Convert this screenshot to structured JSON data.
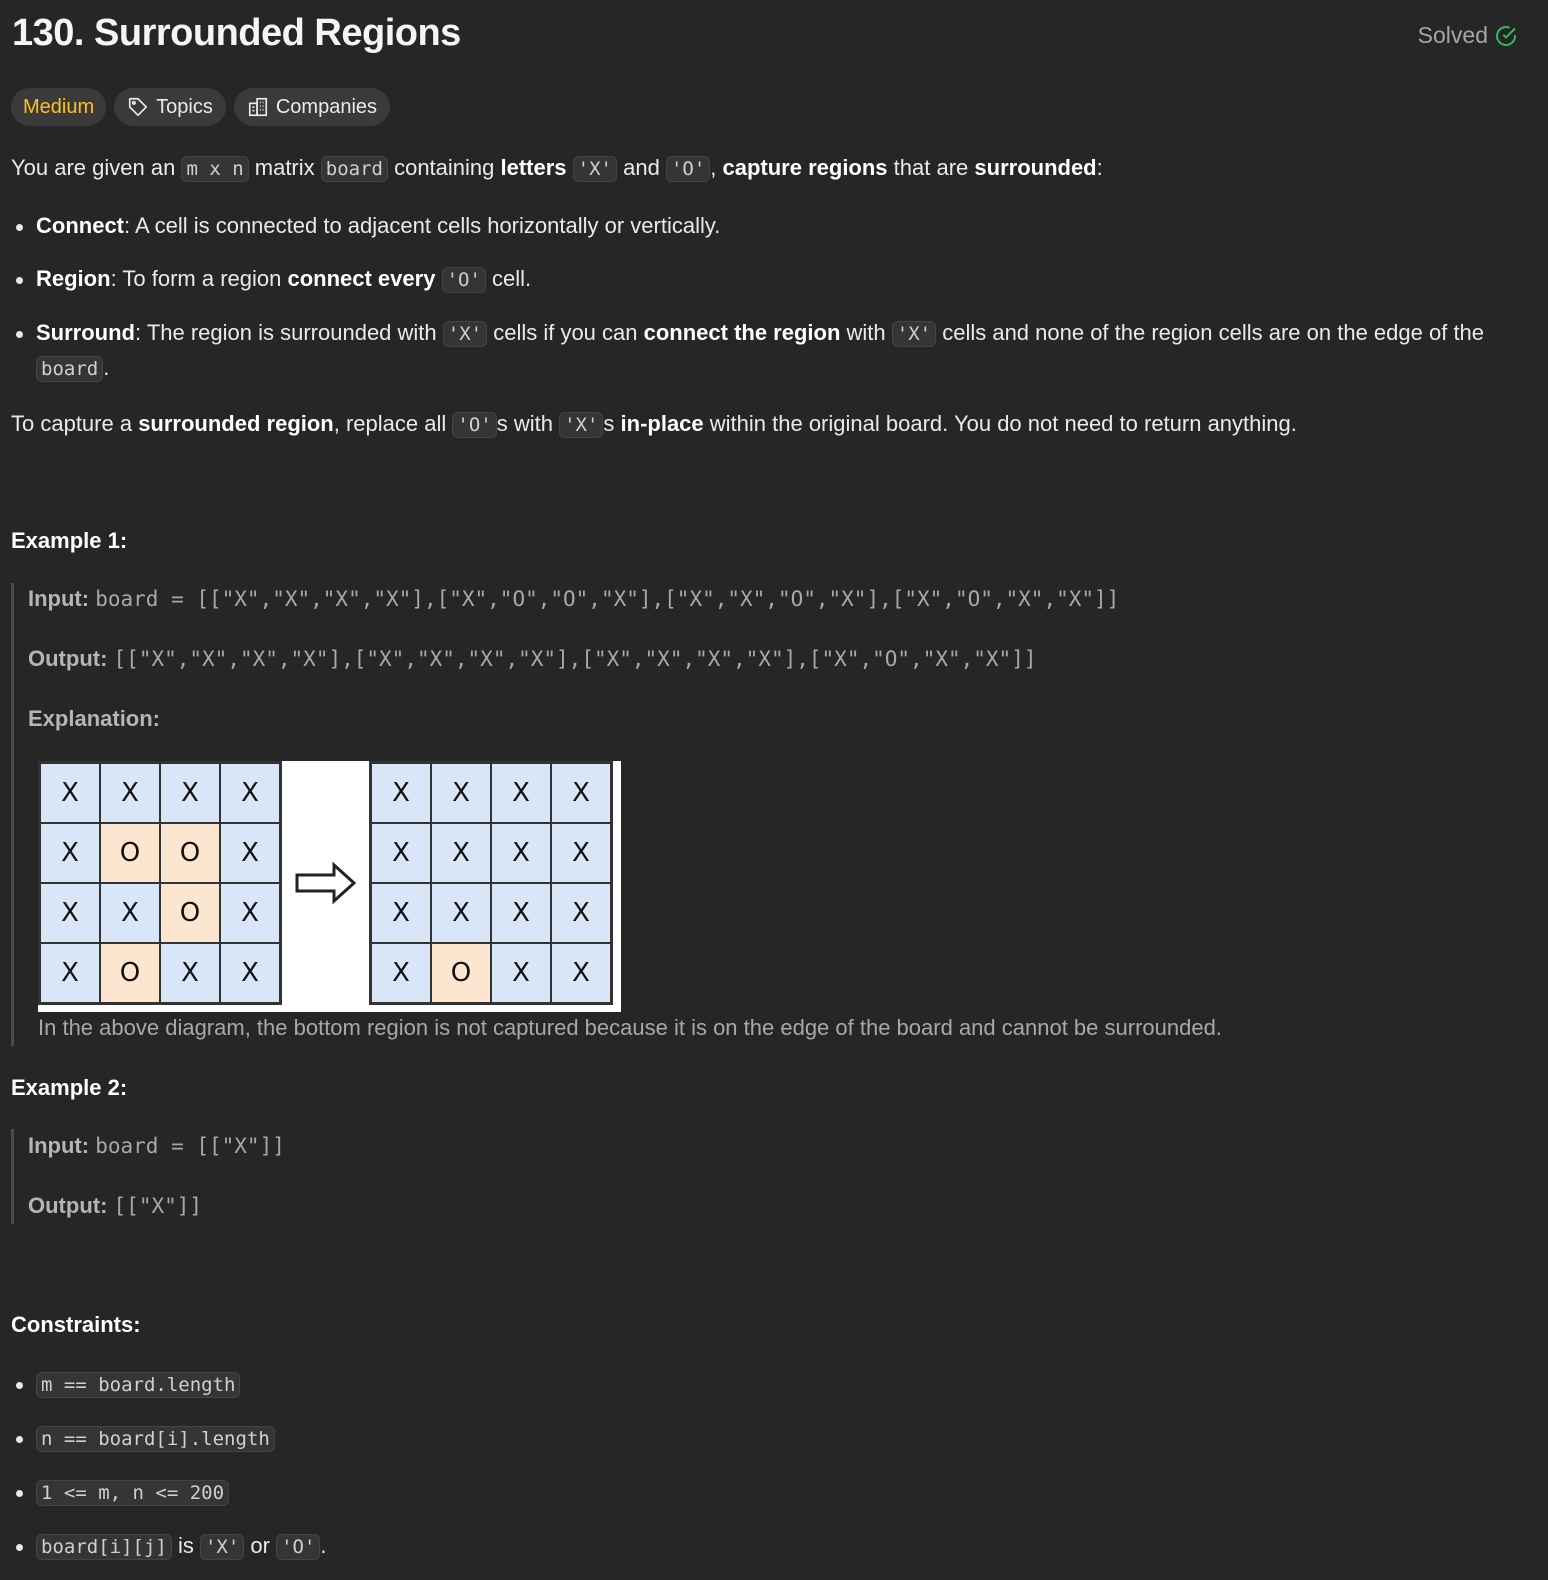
{
  "header": {
    "title": "130. Surrounded Regions",
    "status": "Solved"
  },
  "tags": {
    "difficulty": "Medium",
    "topics": "Topics",
    "companies": "Companies"
  },
  "colors": {
    "background": "#262626",
    "difficulty_medium": "#ffc01e",
    "solved_check": "#2cbb5d",
    "cell_x": "#d8e6f7",
    "cell_o": "#fde6cf"
  },
  "description": {
    "intro": {
      "t1": "You are given an ",
      "c1": "m x n",
      "t2": " matrix ",
      "c2": "board",
      "t3": " containing ",
      "b1": "letters",
      "t4": " ",
      "c3": "'X'",
      "t5": " and ",
      "c4": "'O'",
      "t6": ", ",
      "b2": "capture regions",
      "t7": " that are ",
      "b3": "surrounded",
      "t8": ":"
    },
    "bullets": [
      {
        "b1": "Connect",
        "t1": ": A cell is connected to adjacent cells horizontally or vertically."
      },
      {
        "b1": "Region",
        "t1": ": To form a region ",
        "b2": "connect every",
        "t2": " ",
        "c1": "'O'",
        "t3": " cell."
      },
      {
        "b1": "Surround",
        "t1": ": The region is surrounded with ",
        "c1": "'X'",
        "t2": " cells if you can ",
        "b2": "connect the region",
        "t3": " with ",
        "c2": "'X'",
        "t4": " cells and none of the region cells are on the edge of the ",
        "c3": "board",
        "t5": "."
      }
    ],
    "capture": {
      "t1": "To capture a ",
      "b1": "surrounded region",
      "t2": ", replace all ",
      "c1": "'O'",
      "t3": "s with ",
      "c2": "'X'",
      "t4": "s ",
      "b2": "in-place",
      "t5": " within the original board. You do not need to return anything."
    }
  },
  "examples": [
    {
      "heading": "Example 1:",
      "input_label": "Input:",
      "input_value": "board = [[\"X\",\"X\",\"X\",\"X\"],[\"X\",\"O\",\"O\",\"X\"],[\"X\",\"X\",\"O\",\"X\"],[\"X\",\"O\",\"X\",\"X\"]]",
      "output_label": "Output:",
      "output_value": "[[\"X\",\"X\",\"X\",\"X\"],[\"X\",\"X\",\"X\",\"X\"],[\"X\",\"X\",\"X\",\"X\"],[\"X\",\"O\",\"X\",\"X\"]]",
      "explanation_label": "Explanation:",
      "board_before": [
        [
          "X",
          "X",
          "X",
          "X"
        ],
        [
          "X",
          "O",
          "O",
          "X"
        ],
        [
          "X",
          "X",
          "O",
          "X"
        ],
        [
          "X",
          "O",
          "X",
          "X"
        ]
      ],
      "board_after": [
        [
          "X",
          "X",
          "X",
          "X"
        ],
        [
          "X",
          "X",
          "X",
          "X"
        ],
        [
          "X",
          "X",
          "X",
          "X"
        ],
        [
          "X",
          "O",
          "X",
          "X"
        ]
      ],
      "arrow_icon": "right-arrow-icon",
      "caption": "In the above diagram, the bottom region is not captured because it is on the edge of the board and cannot be surrounded."
    },
    {
      "heading": "Example 2:",
      "input_label": "Input:",
      "input_value": "board = [[\"X\"]]",
      "output_label": "Output:",
      "output_value": "[[\"X\"]]"
    }
  ],
  "constraints": {
    "heading": "Constraints:",
    "items": [
      {
        "c1": "m == board.length"
      },
      {
        "c1": "n == board[i].length"
      },
      {
        "c1": "1 <= m, n <= 200"
      },
      {
        "c1": "board[i][j]",
        "t1": " is ",
        "c2": "'X'",
        "t2": " or ",
        "c3": "'O'",
        "t3": "."
      }
    ]
  }
}
